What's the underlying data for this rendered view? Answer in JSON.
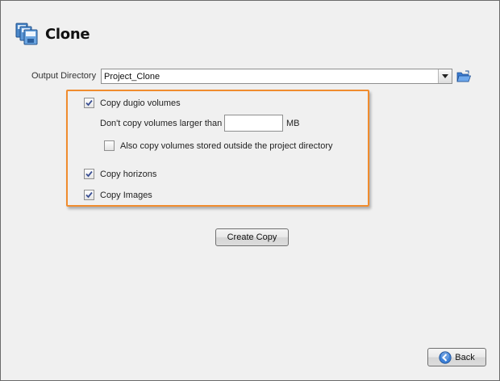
{
  "header": {
    "title": "Clone",
    "icon": "clone-stack-icon"
  },
  "output": {
    "label": "Output Directory",
    "value": "Project_Clone",
    "browse_icon": "open-folder-icon"
  },
  "options": {
    "copy_dugio": {
      "label": "Copy dugio volumes",
      "checked": true
    },
    "size_limit": {
      "label": "Don't copy volumes larger than",
      "value": "",
      "unit": "MB"
    },
    "outside_project": {
      "label": "Also copy volumes stored outside the project directory",
      "checked": false
    },
    "copy_horizons": {
      "label": "Copy horizons",
      "checked": true
    },
    "copy_images": {
      "label": "Copy Images",
      "checked": true
    }
  },
  "actions": {
    "create_label": "Create Copy",
    "back_label": "Back"
  },
  "colors": {
    "highlight_border": "#f08c2e",
    "window_bg": "#f0f0f0"
  }
}
